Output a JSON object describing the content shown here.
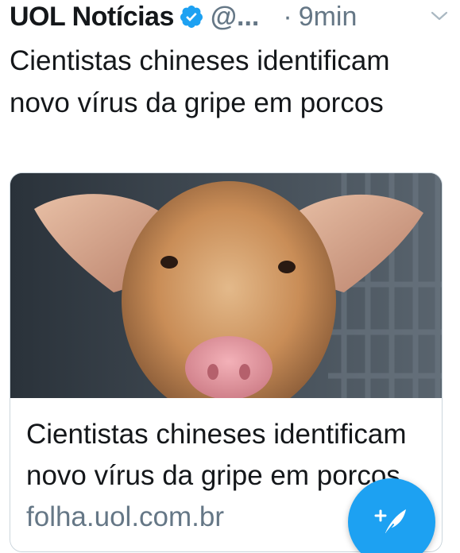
{
  "tweet": {
    "author_name": "UOL Notícias",
    "handle": "@...",
    "dot": "·",
    "time": "9min",
    "verified_icon": "verified-badge-icon",
    "menu_icon": "chevron-down-icon",
    "text": "Cientistas chineses identificam novo vírus da gripe em porcos"
  },
  "card": {
    "image": "pig-photo",
    "title": "Cientistas chineses identificam novo vírus da gripe em porcos",
    "domain": "folha.uol.com.br"
  },
  "fab": {
    "icon": "compose-tweet-icon"
  },
  "colors": {
    "primary_text": "#14171a",
    "secondary_text": "#657786",
    "accent": "#1da1f2",
    "border": "#ccd6dd"
  }
}
